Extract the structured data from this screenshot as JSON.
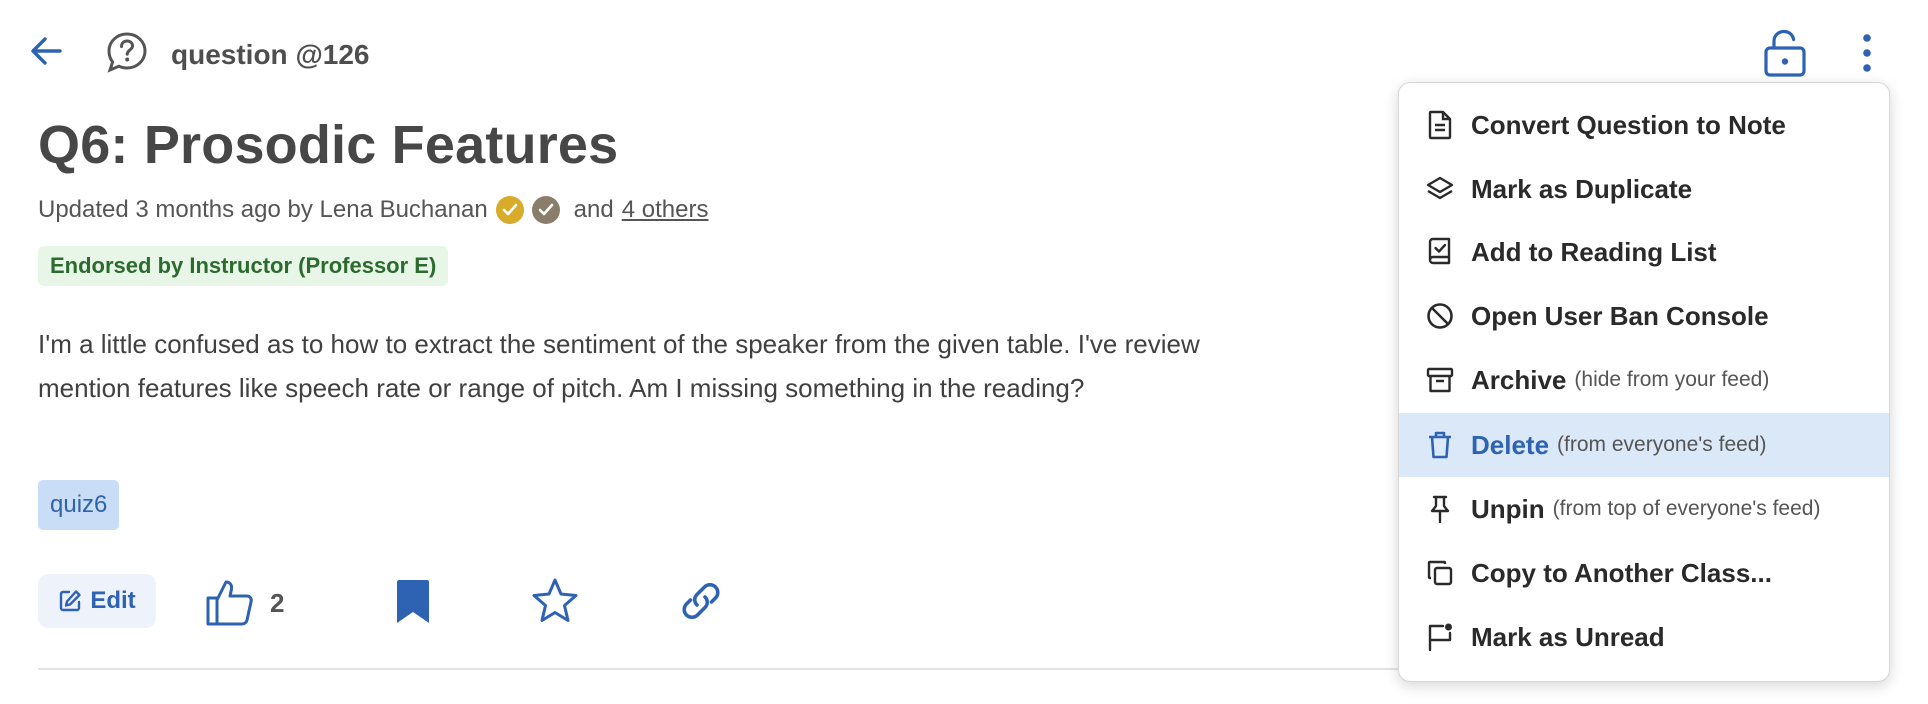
{
  "header": {
    "question_label": "question @126"
  },
  "post": {
    "title": "Q6: Prosodic Features",
    "updated_prefix": "Updated 3 months ago by Lena Buchanan",
    "and_text": "and",
    "others_link": "4 others",
    "endorsement": "Endorsed by Instructor (Professor E)",
    "body_line1": "I'm a little confused as to how to extract the sentiment of the speaker from the given table.  I've review",
    "body_line2": "mention features like speech rate or range of pitch.  Am I missing something in the reading?",
    "tag": "quiz6"
  },
  "actions": {
    "edit_label": "Edit",
    "like_count": "2"
  },
  "colors": {
    "accent": "#2d63b2",
    "gold_badge": "#d9ab2a",
    "grey_badge": "#8a7e6a",
    "menu_active_bg": "#dbe8f8"
  },
  "menu": {
    "items": [
      {
        "label": "Convert Question to Note",
        "hint": "",
        "icon": "document-icon"
      },
      {
        "label": "Mark as Duplicate",
        "hint": "",
        "icon": "layers-icon"
      },
      {
        "label": "Add to Reading List",
        "hint": "",
        "icon": "reading-list-icon"
      },
      {
        "label": "Open User Ban Console",
        "hint": "",
        "icon": "ban-icon"
      },
      {
        "label": "Archive",
        "hint": "(hide from your feed)",
        "icon": "archive-icon"
      },
      {
        "label": "Delete",
        "hint": "(from everyone's feed)",
        "icon": "trash-icon",
        "active": true
      },
      {
        "label": "Unpin",
        "hint": "(from top of everyone's feed)",
        "icon": "pin-icon"
      },
      {
        "label": "Copy to Another Class...",
        "hint": "",
        "icon": "copy-icon"
      },
      {
        "label": "Mark as Unread",
        "hint": "",
        "icon": "flag-icon"
      }
    ]
  }
}
